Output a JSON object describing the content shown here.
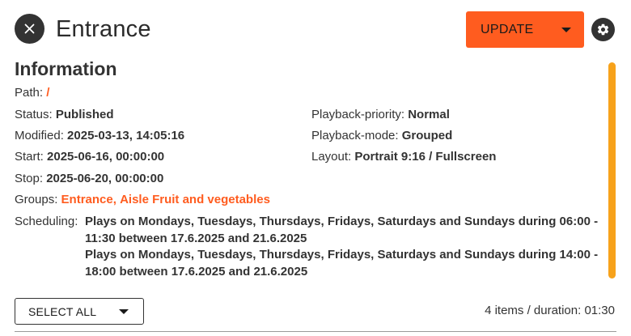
{
  "header": {
    "title": "Entrance",
    "update_label": "UPDATE",
    "close_icon": "close-icon",
    "settings_icon": "gear-icon"
  },
  "info": {
    "section_title": "Information",
    "path_label": "Path:",
    "path_value": "/",
    "status_label": "Status:",
    "status_value": "Published",
    "modified_label": "Modified:",
    "modified_value": "2025-03-13, 14:05:16",
    "start_label": "Start:",
    "start_value": "2025-06-16, 00:00:00",
    "stop_label": "Stop:",
    "stop_value": "2025-06-20, 00:00:00",
    "groups_label": "Groups:",
    "groups": [
      "Entrance,",
      "Aisle Fruit and vegetables"
    ],
    "playback_priority_label": "Playback-priority:",
    "playback_priority_value": "Normal",
    "playback_mode_label": "Playback-mode:",
    "playback_mode_value": "Grouped",
    "layout_label": "Layout:",
    "layout_value": "Portrait 9:16 / Fullscreen",
    "scheduling_label": "Scheduling:",
    "scheduling": [
      "Plays on Mondays, Tuesdays, Thursdays, Fridays, Saturdays and Sundays during 06:00 - 11:30 between 17.6.2025 and 21.6.2025",
      "Plays on Mondays, Tuesdays, Thursdays, Fridays, Saturdays and Sundays during 14:00 - 18:00 between 17.6.2025 and 21.6.2025"
    ]
  },
  "footer": {
    "select_all_label": "SELECT ALL",
    "summary": "4 items /  duration: 01:30"
  },
  "colors": {
    "accent": "#ff5c1f",
    "scrollbar": "#f7a21b",
    "dark": "#333333"
  }
}
